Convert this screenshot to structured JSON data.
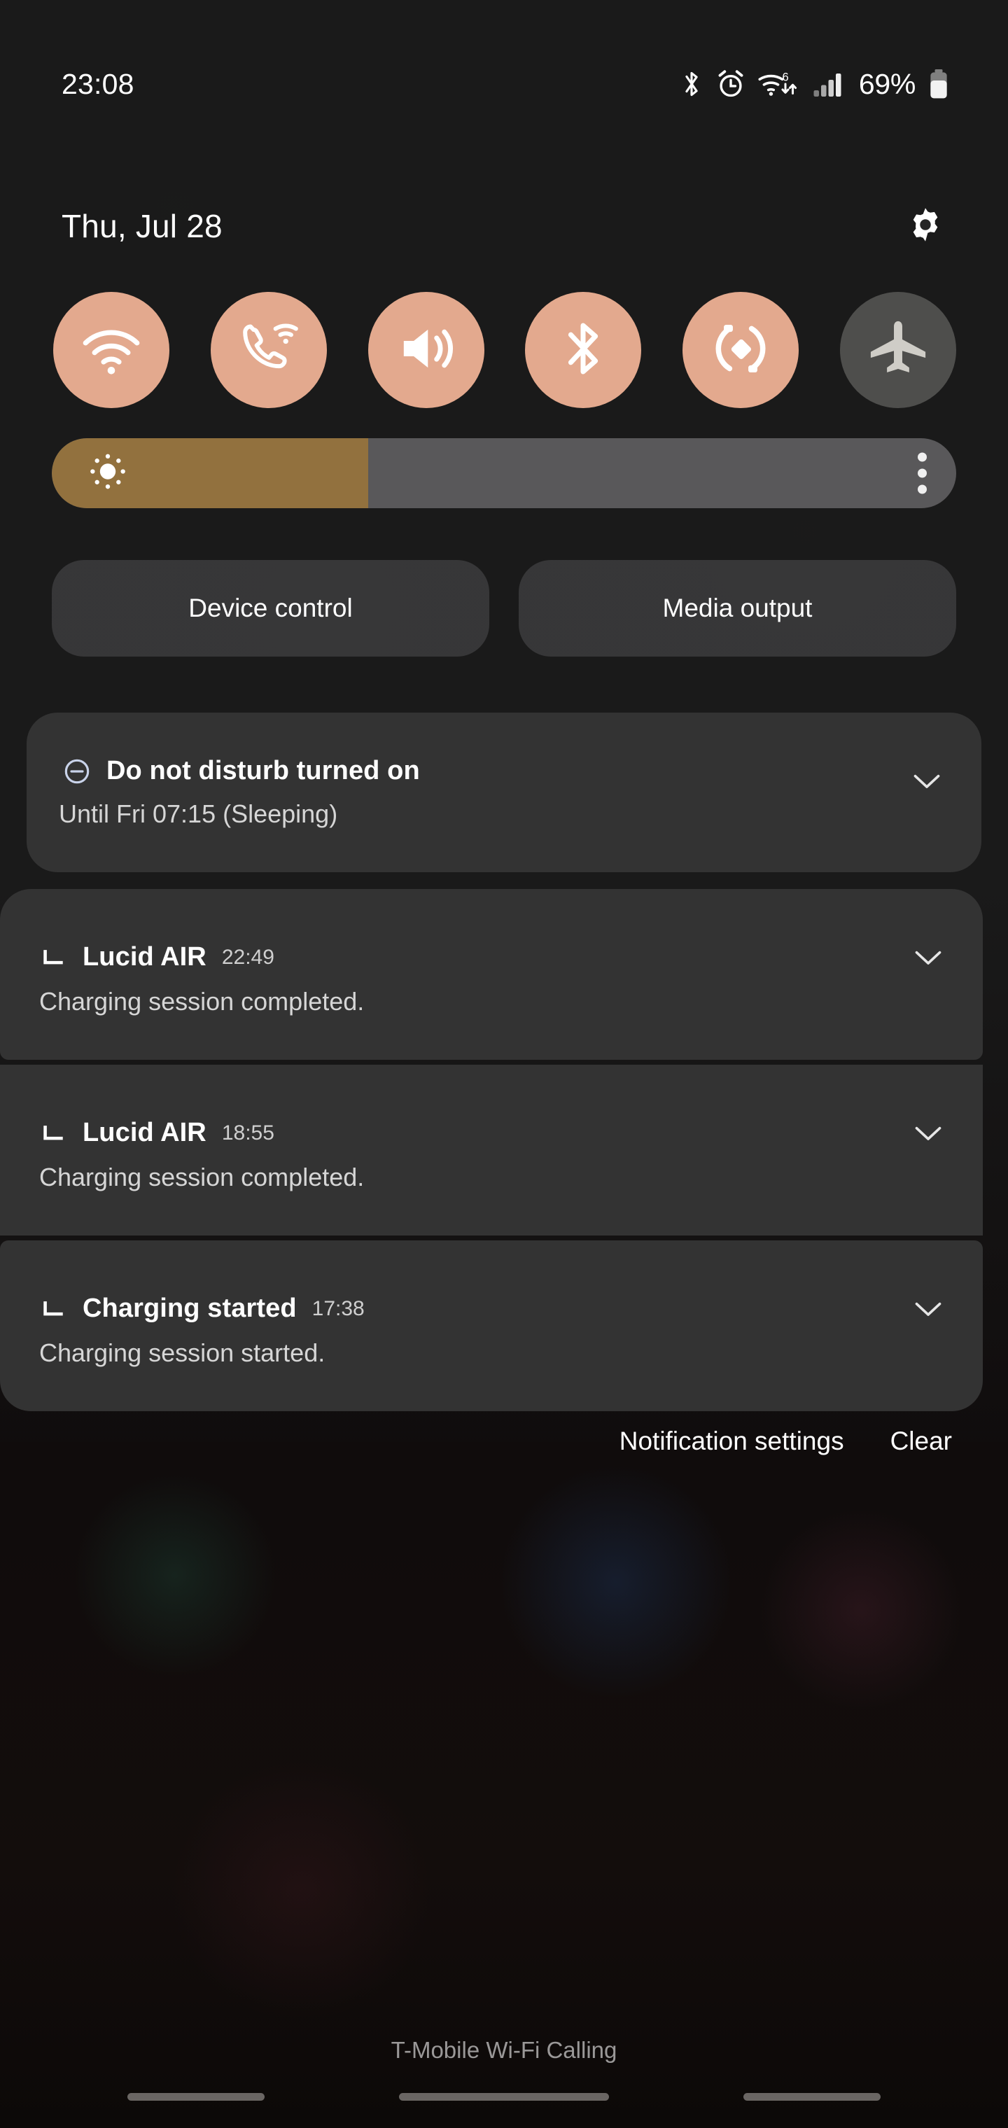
{
  "statusbar": {
    "clock": "23:08",
    "battery_percent": "69%",
    "icons": [
      "bluetooth-icon",
      "alarm-icon",
      "wifi-6-icon",
      "signal-bars-icon",
      "battery-icon"
    ],
    "wifi_generation": "6"
  },
  "header": {
    "date": "Thu, Jul 28",
    "settings_icon": "gear-icon"
  },
  "quick_settings": {
    "accent_on": "#e3a98e",
    "accent_off": "#7a7a76",
    "toggles": [
      {
        "name": "wifi",
        "icon": "wifi-icon",
        "state": "on"
      },
      {
        "name": "wifi-calling",
        "icon": "phone-wifi-icon",
        "state": "on"
      },
      {
        "name": "sound",
        "icon": "speaker-icon",
        "state": "on"
      },
      {
        "name": "bluetooth",
        "icon": "bluetooth-icon",
        "state": "on"
      },
      {
        "name": "auto-rotate",
        "icon": "auto-rotate-icon",
        "state": "on"
      },
      {
        "name": "airplane",
        "icon": "airplane-icon",
        "state": "off"
      }
    ]
  },
  "brightness": {
    "icon": "brightness-sun-icon",
    "level_percent": 35,
    "fill_color": "#92713e",
    "track_color": "#59585a",
    "more_icon": "more-vertical-icon"
  },
  "shortcuts": {
    "device_control": "Device control",
    "media_output": "Media output"
  },
  "notifications": {
    "dnd": {
      "icon": "do-not-disturb-icon",
      "title": "Do not disturb turned on",
      "body": "Until Fri 07:15 (Sleeping)",
      "expand_icon": "chevron-down-icon"
    },
    "group": [
      {
        "icon": "lucid-app-icon",
        "title": "Lucid AIR",
        "time": "22:49",
        "body": "Charging session completed.",
        "expand_icon": "chevron-down-icon"
      },
      {
        "icon": "lucid-app-icon",
        "title": "Lucid AIR",
        "time": "18:55",
        "body": "Charging session completed.",
        "expand_icon": "chevron-down-icon"
      },
      {
        "icon": "lucid-app-icon",
        "title": "Charging started",
        "time": "17:38",
        "body": "Charging session started.",
        "expand_icon": "chevron-down-icon"
      }
    ]
  },
  "footer": {
    "notification_settings": "Notification settings",
    "clear": "Clear"
  },
  "carrier": {
    "label": "T-Mobile Wi-Fi Calling"
  },
  "navbar": {
    "left": "recents-pill",
    "home": "home-pill",
    "right": "back-pill"
  }
}
